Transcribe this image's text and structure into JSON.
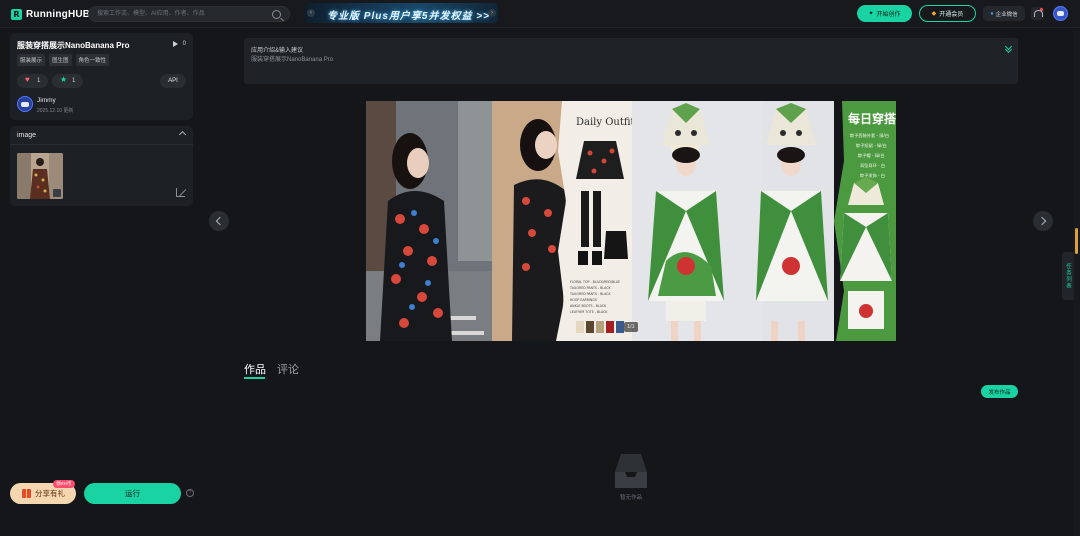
{
  "topbar": {
    "brand": "RunningHUB",
    "search_placeholder": "搜索工作流、模型、AI应用、作者、作品",
    "banner_text": "专业版 Plus用户享5并发权益 >>",
    "start_creating": "开始创作",
    "open_membership": "开通会员",
    "enterprise": "企业微信"
  },
  "app": {
    "title": "服装穿搭展示NanoBanana Pro",
    "run_count": "0",
    "tags": [
      "服装展示",
      "图生图",
      "角色一致性"
    ],
    "likes": "1",
    "favorites": "1",
    "api_label": "API",
    "author": "Jimmy",
    "updated": "2025.12.10 更新"
  },
  "inputs": {
    "section_title": "image"
  },
  "actions": {
    "share_label": "分享有礼",
    "share_badge": "领RH币",
    "run_label": "运行"
  },
  "intro": {
    "title": "应用介绍&输入建议",
    "description": "服装穿搭展示NanoBanana Pro"
  },
  "gallery": {
    "counter": "1/1",
    "outfit_title": "Daily Outfit",
    "daily_title": "每日穿搭",
    "outfit_lines": [
      "FLORAL TOP - BLACK/RED/BLUE",
      "TAILORED PANTS - BLACK",
      "TAILORED PANTS - BLACK",
      "HOOP EARRINGS",
      "ANKLE BOOTS - BLACK",
      "LEATHER TOTE - BLACK"
    ],
    "daily_lines": [
      "粽子西装外套 - 绿/白",
      "粽子短裙 - 绿/白",
      "粽子帽 - 绿/白",
      "耳坠耳环 - 白",
      "粽子发饰 - 白"
    ]
  },
  "tabs": {
    "works": "作品",
    "comments": "评论"
  },
  "works": {
    "publish_label": "发布作品",
    "empty_text": "暂无作品"
  },
  "side": {
    "task_list": "任务列表"
  }
}
